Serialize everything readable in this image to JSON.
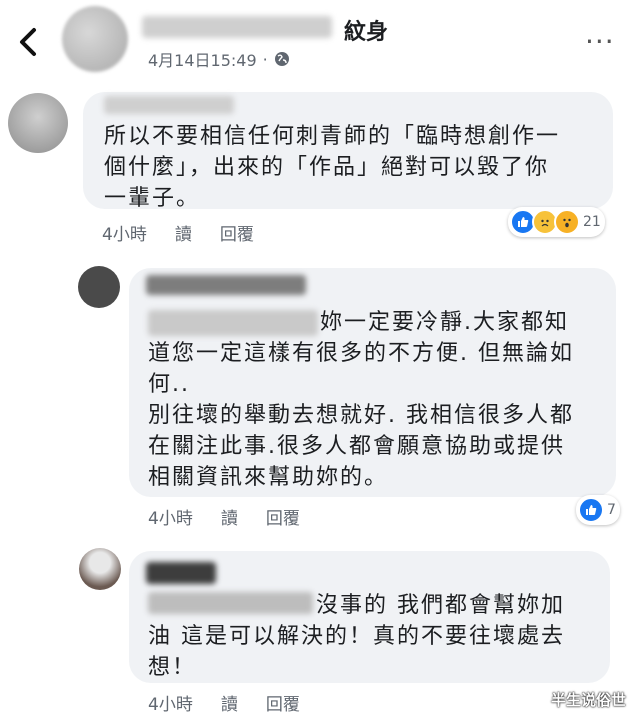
{
  "header": {
    "title_suffix": "紋身",
    "timestamp": "4月14日15:49",
    "dot": "·",
    "more": "···"
  },
  "comments": [
    {
      "lines": [
        "所以不要相信任何刺青師的「臨時想創作一",
        "個什麼」，出來的「作品」絕對可以毀了你",
        "一輩子。"
      ],
      "time": "4小時",
      "read": "讀",
      "reply": "回覆",
      "reactions": {
        "icons": [
          "like-icon",
          "sad-icon",
          "wow-icon"
        ],
        "count": "21"
      }
    },
    {
      "lines": [
        "妳一定要冷靜.大家都知",
        "道您一定這樣有很多的不方便. 但無論如",
        "何..",
        "別往壞的舉動去想就好. 我相信很多人都",
        "在關注此事.很多人都會願意協助或提供",
        "相關資訊來幫助妳的。"
      ],
      "time": "4小時",
      "read": "讀",
      "reply": "回覆",
      "reactions": {
        "icons": [
          "like-icon"
        ],
        "count": "7"
      }
    },
    {
      "lines": [
        "沒事的 我們都會幫妳加",
        "油 這是可以解決的！真的不要往壞處去",
        "想！"
      ],
      "time": "4小時",
      "read": "讀",
      "reply": "回覆"
    }
  ],
  "watermark": "半生说俗世",
  "colors": {
    "like": "#1877f2",
    "bubble": "#f0f2f5",
    "meta": "#606770"
  }
}
